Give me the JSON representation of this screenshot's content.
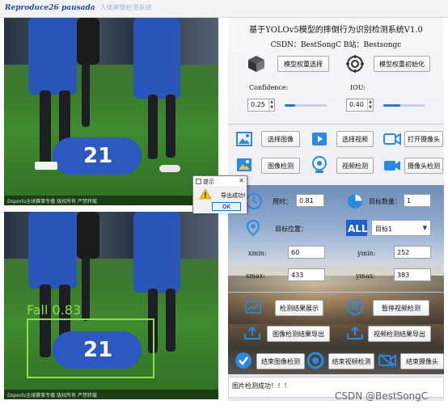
{
  "window": {
    "title": "Reproduce26 pausada",
    "title_ghost": "人体摔倒检测系统"
  },
  "header": {
    "title": "基于YOLOv5模型的摔倒行为识别检测系统V1.0",
    "subtitle": "CSDN：BestSongC  B站：Bestsongc"
  },
  "model": {
    "select_label": "模型权重选择",
    "init_label": "模型权重初始化"
  },
  "params": {
    "confidence_label": "Confidence:",
    "confidence_value": "0.25",
    "confidence_level": 0.25,
    "iou_label": "IOU:",
    "iou_value": "0.40",
    "iou_level": 0.4
  },
  "media": {
    "select_image": "选择图像",
    "select_video": "选择视频",
    "open_camera": "打开摄像头",
    "detect_image": "图像检测",
    "detect_video": "视频检测",
    "detect_camera": "摄像头检测"
  },
  "results": {
    "time_label": "用时：",
    "time_value": "0.81",
    "count_label": "目标数量：",
    "count_value": "1",
    "position_label": "目标位置：",
    "target_select": "目标1",
    "xmin_label": "xmin:",
    "xmin_value": "60",
    "ymin_label": "ymin:",
    "ymin_value": "252",
    "xmax_label": "xmax:",
    "xmax_value": "433",
    "ymax_label": "ymax:",
    "ymax_value": "383"
  },
  "actions": {
    "show_results": "检测结果展示",
    "pause_video": "暂停视频检测",
    "export_image": "图像检测结果导出",
    "export_video": "视频检测结果导出",
    "end_image": "结束图像检测",
    "end_video": "结束视频检测",
    "end_camera": "结束摄像头"
  },
  "status": {
    "message": "图片检测成功！！！"
  },
  "detection": {
    "label": "Fall 0.83",
    "box_color": "#8ee04a"
  },
  "video_overlay": {
    "jersey_number": "21",
    "watermark": "Dsports全球赛事专播 版权所有 严禁转载"
  },
  "dialog": {
    "title": "提示",
    "message": "导出成功!",
    "ok_label": "OK"
  },
  "footer": {
    "watermark": "CSDN @BestSongC"
  },
  "colors": {
    "accent": "#2b77d4",
    "icon_blue": "#2b8ae0",
    "detect_green": "#8ee04a"
  }
}
